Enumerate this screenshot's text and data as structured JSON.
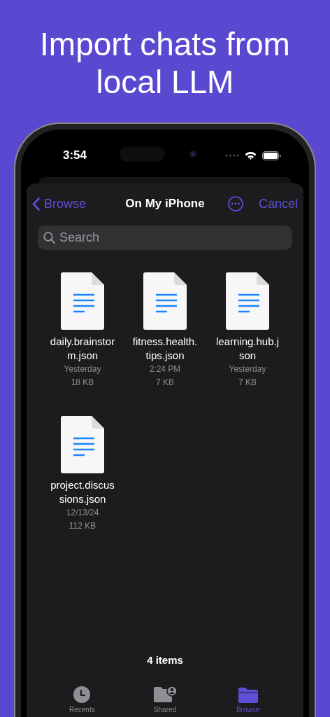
{
  "headline": [
    "Import chats from",
    "local LLM"
  ],
  "status_bar": {
    "time": "3:54"
  },
  "nav": {
    "back": "Browse",
    "title": "On My iPhone",
    "action": "Cancel"
  },
  "search": {
    "placeholder": "Search"
  },
  "files": [
    {
      "name_lines": [
        "daily.brainstor",
        "m.json"
      ],
      "date": "Yesterday",
      "size": "18 KB"
    },
    {
      "name_lines": [
        "fitness.health.",
        "tips.json"
      ],
      "date": "2:24 PM",
      "size": "7 KB"
    },
    {
      "name_lines": [
        "learning.hub.j",
        "son"
      ],
      "date": "Yesterday",
      "size": "7 KB"
    },
    {
      "name_lines": [
        "project.discus",
        "sions.json"
      ],
      "date": "12/13/24",
      "size": "112 KB"
    }
  ],
  "item_count": "4 items",
  "tabs": [
    {
      "kind": "recents",
      "label": "Recents",
      "selected": false
    },
    {
      "kind": "shared",
      "label": "Shared",
      "selected": false
    },
    {
      "kind": "browse",
      "label": "Browse",
      "selected": true
    }
  ]
}
